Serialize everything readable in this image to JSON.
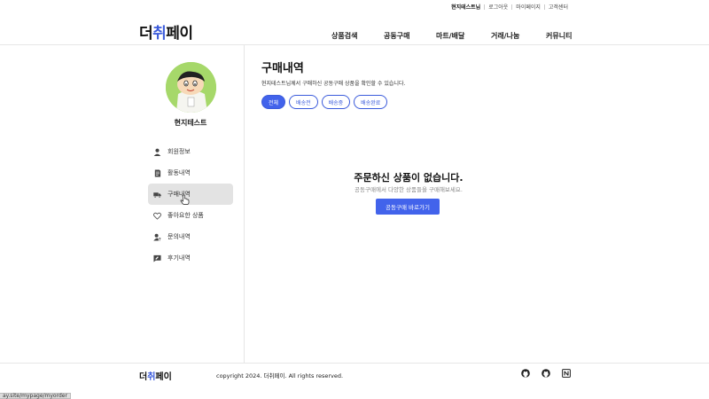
{
  "util": {
    "user": "현지테스트님",
    "links": [
      "로그아웃",
      "마이페이지",
      "고객센터"
    ]
  },
  "header": {
    "logo_part1": "더",
    "logo_part2": "취",
    "logo_part3": "페이",
    "nav": [
      "상품검색",
      "공동구매",
      "마트/배달",
      "거래/나눔",
      "커뮤니티"
    ]
  },
  "profile": {
    "name": "현지테스트"
  },
  "sidebar": {
    "items": [
      {
        "label": "회원정보",
        "icon": "user-icon"
      },
      {
        "label": "활동내역",
        "icon": "document-icon"
      },
      {
        "label": "구매내역",
        "icon": "truck-icon",
        "active": true
      },
      {
        "label": "좋아요한 상품",
        "icon": "heart-icon"
      },
      {
        "label": "문의내역",
        "icon": "person-question-icon"
      },
      {
        "label": "후기내역",
        "icon": "review-icon"
      }
    ]
  },
  "main": {
    "title": "구매내역",
    "description": "현지테스트님께서 구매하신 공동구매 상품을 확인할 수 있습니다.",
    "filters": [
      "전체",
      "배송전",
      "배송중",
      "배송완료"
    ],
    "empty_title": "주문하신 상품이 없습니다.",
    "empty_sub": "공동구매에서 다양한 상품들을 구매해보세요.",
    "cta": "공동구매 바로가기"
  },
  "footer": {
    "logo_part1": "더",
    "logo_part2": "취",
    "logo_part3": "페이",
    "copyright": "copyright 2024. 더취페이. All rights reserved.",
    "icons": [
      "github-icon",
      "github-icon",
      "notion-icon"
    ]
  },
  "status_url": "ay.site/mypage/myorder",
  "colors": {
    "accent": "#4263eb",
    "active_bg": "#e3e3e3"
  }
}
